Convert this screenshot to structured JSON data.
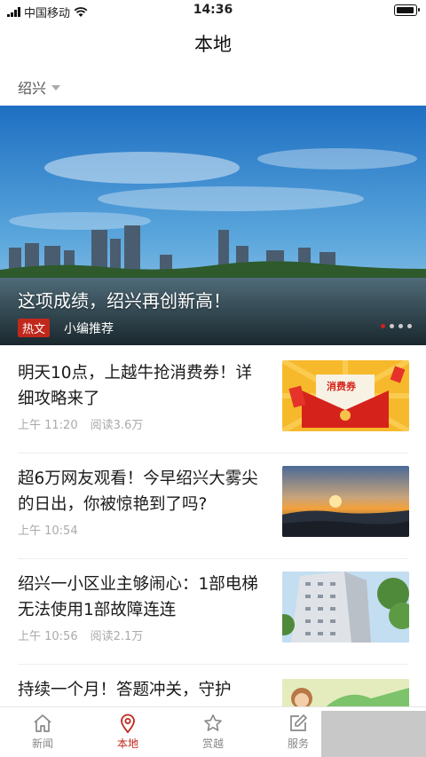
{
  "status_bar": {
    "carrier": "中国移动",
    "time": "14:36"
  },
  "header": {
    "title": "本地"
  },
  "location": {
    "city": "绍兴"
  },
  "banner": {
    "headline": "这项成绩，绍兴再创新高！",
    "tag": "热文",
    "subtitle": "小编推荐",
    "slide_count": 4,
    "active_slide": 1
  },
  "news": [
    {
      "headline": "明天10点，上越牛抢消费券！详细攻略来了",
      "time": "上午 11:20",
      "reads": "阅读3.6万",
      "thumb_text": "消费券"
    },
    {
      "headline": "超6万网友观看！今早绍兴大雾尖的日出，你被惊艳到了吗?",
      "time": "上午 10:54",
      "reads": ""
    },
    {
      "headline": "绍兴一小区业主够闹心：1部电梯无法使用1部故障连连",
      "time": "上午 10:56",
      "reads": "阅读2.1万"
    },
    {
      "headline": "持续一个月！答题冲关，守护",
      "time": "",
      "reads": ""
    }
  ],
  "tabs": [
    {
      "label": "新闻",
      "icon": "home-icon"
    },
    {
      "label": "本地",
      "icon": "location-pin-icon",
      "active": true
    },
    {
      "label": "赏越",
      "icon": "star-icon"
    },
    {
      "label": "服务",
      "icon": "edit-icon"
    }
  ],
  "colors": {
    "accent": "#c0281c",
    "text": "#1a1a1a",
    "meta": "#aaaaaa"
  }
}
